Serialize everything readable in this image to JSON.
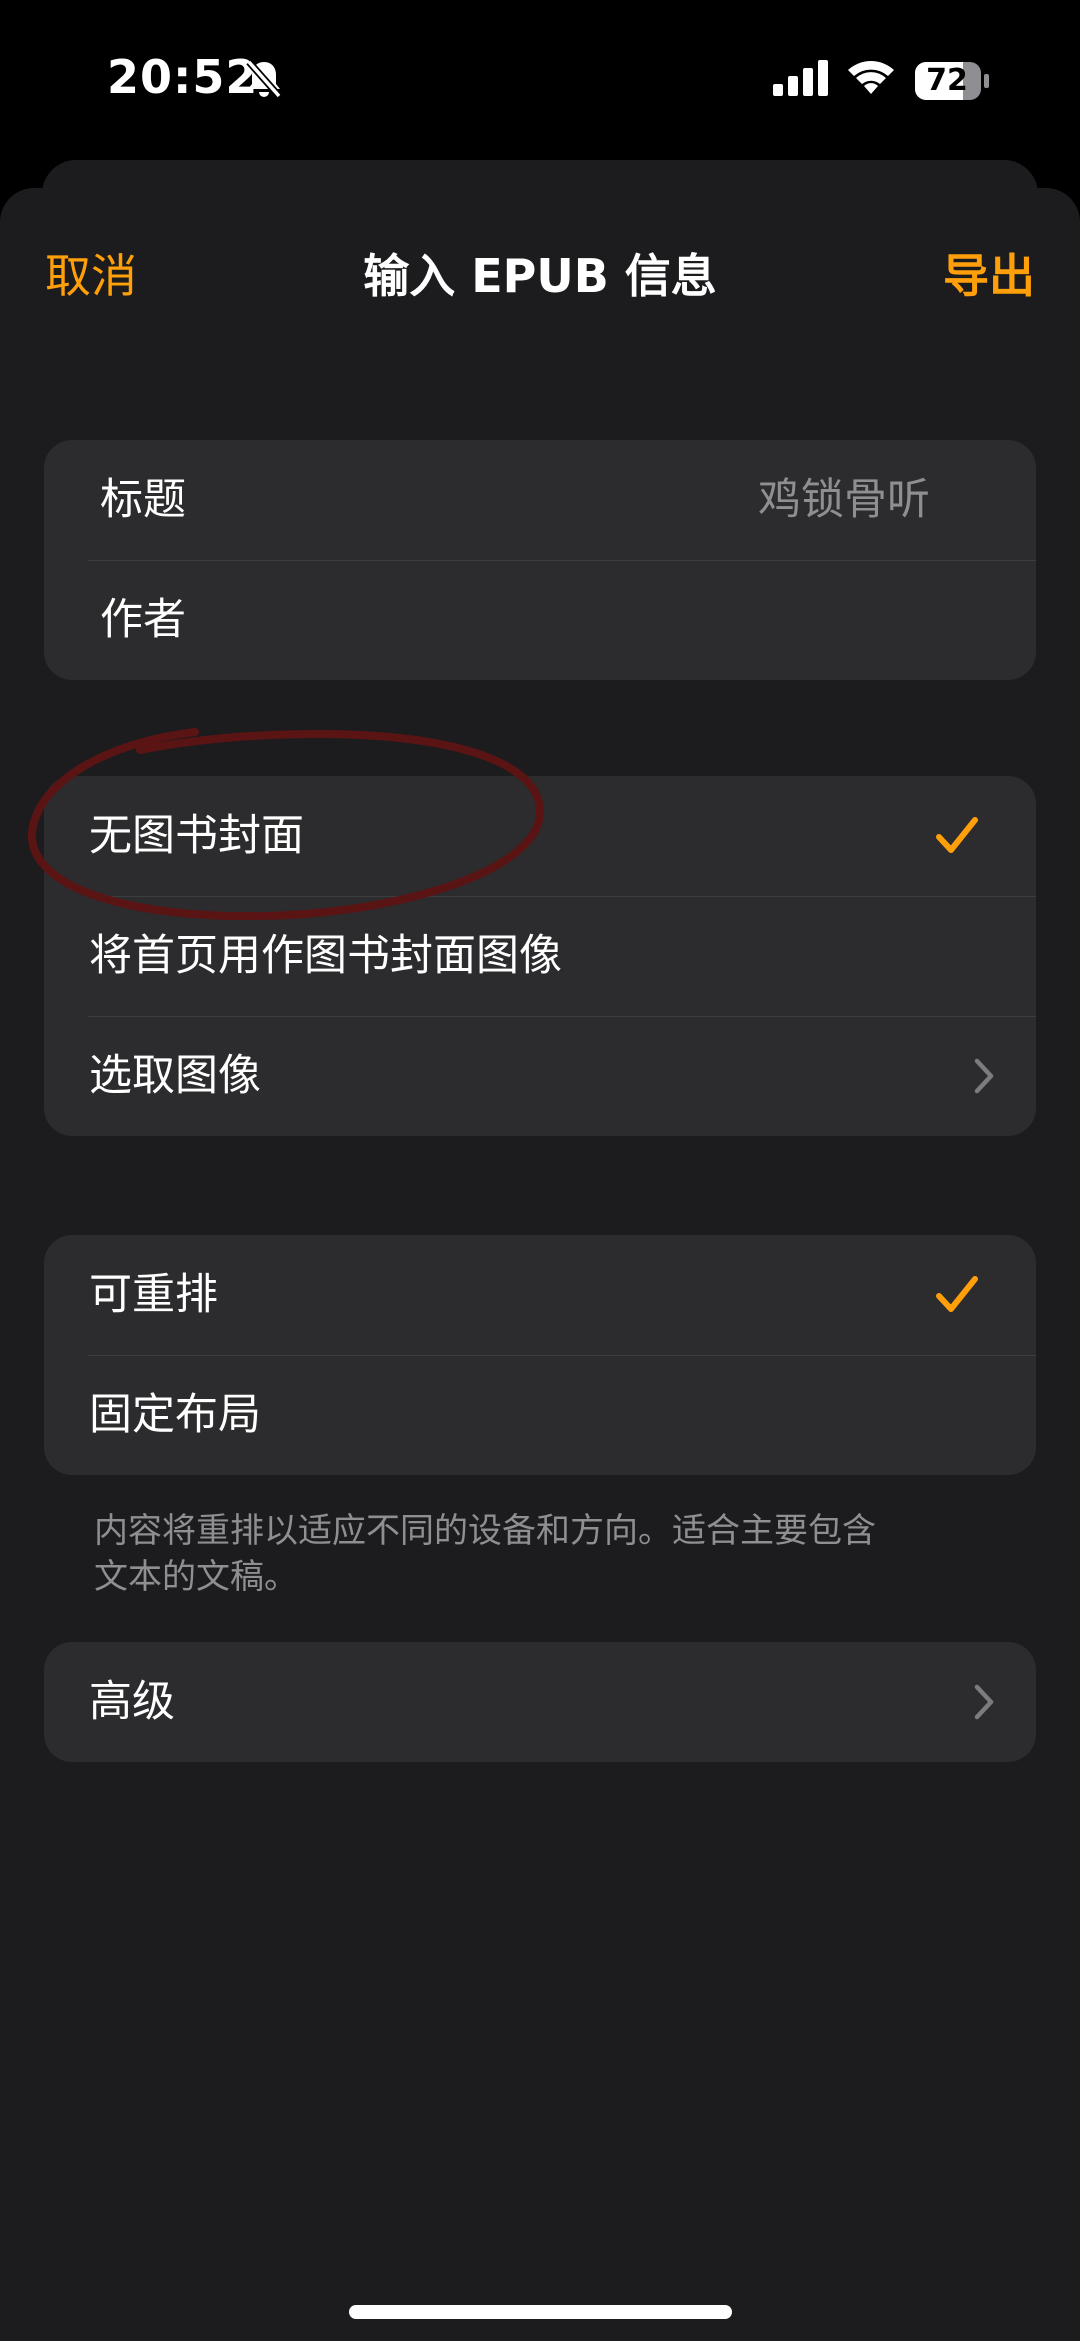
{
  "status_bar": {
    "time": "20:52",
    "battery_level": "72",
    "icons": [
      "bell-slash-icon",
      "cellular-signal-icon",
      "wifi-icon",
      "battery-icon"
    ]
  },
  "nav": {
    "cancel": "取消",
    "title": "输入 EPUB 信息",
    "export": "导出"
  },
  "info": {
    "title_label": "标题",
    "title_value": "鸡锁骨听",
    "author_label": "作者"
  },
  "cover": {
    "options": [
      "无图书封面",
      "将首页用作图书封面图像",
      "选取图像"
    ],
    "selected": "无图书封面"
  },
  "layout": {
    "options": [
      "可重排",
      "固定布局"
    ],
    "selected": "可重排",
    "footnote_line1": "内容将重排以适应不同的设备和方向。适合主要包含",
    "footnote_line2": "文本的文稿。"
  },
  "advanced": {
    "label": "高级"
  },
  "colors": {
    "accent": "#ff9f0a",
    "background": "#1c1c1e",
    "cell": "#2c2c2e",
    "secondary_text": "#8e8e93",
    "annotation": "#5a1414"
  }
}
